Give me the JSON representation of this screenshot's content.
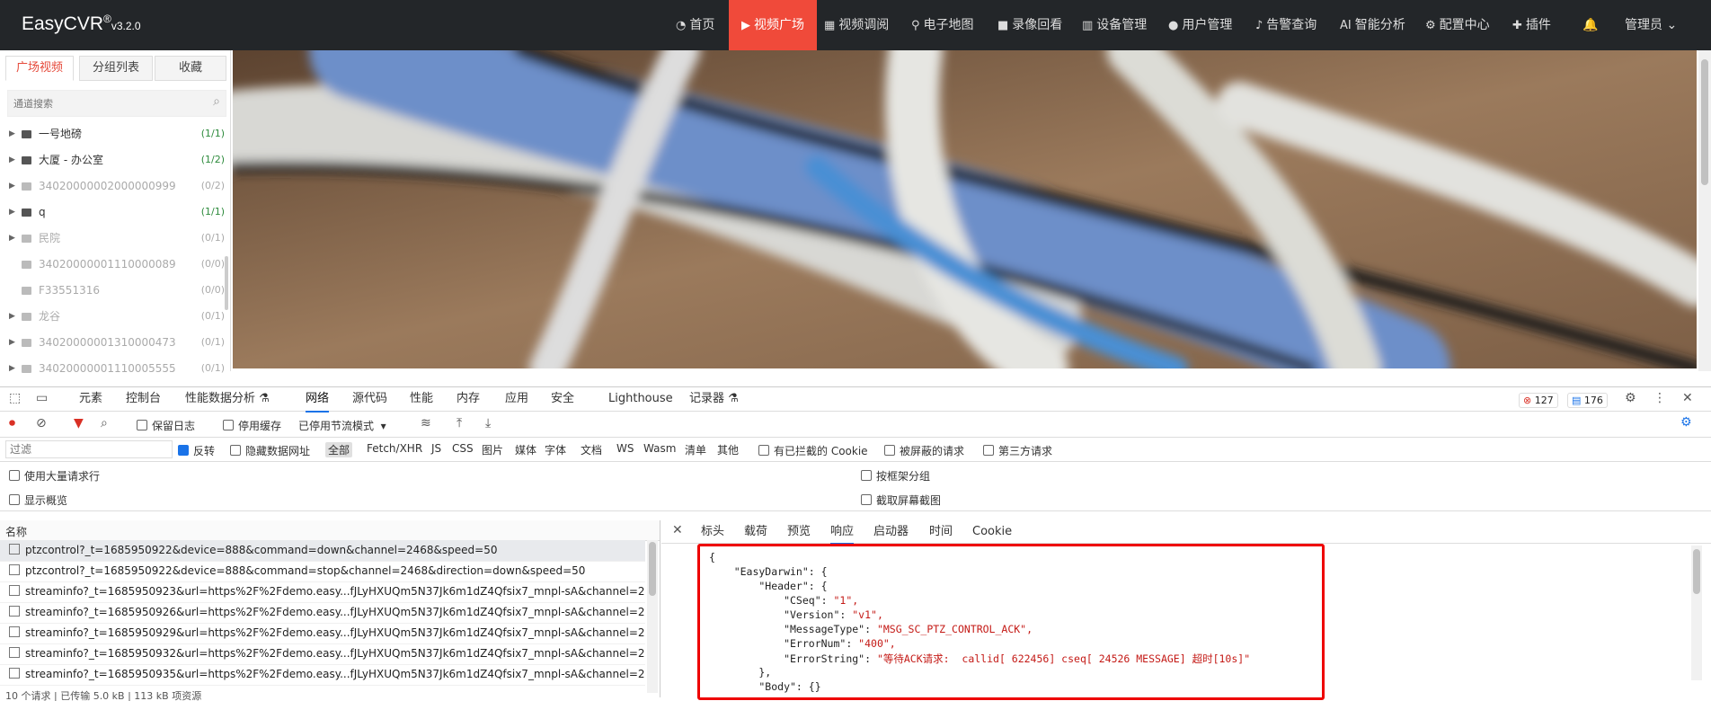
{
  "brand": {
    "name": "EasyCVR",
    "sup": "®",
    "version": "v3.2.0"
  },
  "nav": [
    {
      "icon": "dashboard-icon",
      "label": "首页"
    },
    {
      "icon": "play-circle-icon",
      "label": "视频广场",
      "active": true
    },
    {
      "icon": "grid-icon",
      "label": "视频调阅"
    },
    {
      "icon": "map-pin-icon",
      "label": "电子地图"
    },
    {
      "icon": "video-camera-icon",
      "label": "录像回看"
    },
    {
      "icon": "server-icon",
      "label": "设备管理"
    },
    {
      "icon": "user-icon",
      "label": "用户管理"
    },
    {
      "icon": "alarm-icon",
      "label": "告警查询"
    },
    {
      "icon": "ai-icon",
      "label": "智能分析"
    },
    {
      "icon": "gear-icon",
      "label": "配置中心"
    },
    {
      "icon": "puzzle-icon",
      "label": "插件"
    }
  ],
  "user": {
    "name": "管理员",
    "bell": "bell-icon"
  },
  "sidebar": {
    "tabs": [
      "广场视频",
      "分组列表",
      "收藏"
    ],
    "search_placeholder": "通道搜索",
    "tree": [
      {
        "label": "一号地磅",
        "count": "(1/1)",
        "online": true,
        "expand": true
      },
      {
        "label": "大厦 - 办公室",
        "count": "(1/2)",
        "online": true,
        "expand": true
      },
      {
        "label": "34020000002000000999",
        "count": "(0/2)",
        "online": false,
        "expand": true
      },
      {
        "label": "q",
        "count": "(1/1)",
        "online": true,
        "expand": true
      },
      {
        "label": "民院",
        "count": "(0/1)",
        "online": false,
        "expand": true
      },
      {
        "label": "34020000001110000089",
        "count": "(0/0)",
        "online": false,
        "expand": false
      },
      {
        "label": "F33551316",
        "count": "(0/0)",
        "online": false,
        "expand": false
      },
      {
        "label": "龙谷",
        "count": "(0/1)",
        "online": false,
        "expand": true
      },
      {
        "label": "34020000001310000473",
        "count": "(0/1)",
        "online": false,
        "expand": true
      },
      {
        "label": "34020000001110005555",
        "count": "(0/1)",
        "online": false,
        "expand": true
      }
    ]
  },
  "devtools": {
    "tabs": [
      "元素",
      "控制台",
      "性能数据分析 ⚗",
      "网络",
      "源代码",
      "性能",
      "内存",
      "应用",
      "安全",
      "Lighthouse",
      "记录器 ⚗"
    ],
    "active_tab": "网络",
    "errors": "127",
    "messages": "176",
    "toolbar": {
      "preserve_log": "保留日志",
      "disable_cache": "停用缓存",
      "throttle": "已停用节流模式"
    },
    "filter": {
      "placeholder": "过滤",
      "invert": "反转",
      "hide_data_urls": "隐藏数据网址",
      "types": [
        "全部",
        "Fetch/XHR",
        "JS",
        "CSS",
        "图片",
        "媒体",
        "字体",
        "文档",
        "WS",
        "Wasm",
        "清单",
        "其他"
      ],
      "blocked_cookies": "有已拦截的 Cookie",
      "blocked_requests": "被屏蔽的请求",
      "third_party": "第三方请求"
    },
    "options": {
      "big_rows": "使用大量请求行",
      "overview": "显示概览",
      "group_by_frame": "按框架分组",
      "screenshots": "截取屏幕截图"
    },
    "name_header": "名称",
    "requests": [
      "ptzcontrol?_t=1685950922&device=888&command=down&channel=2468&speed=50",
      "ptzcontrol?_t=1685950922&device=888&command=stop&channel=2468&direction=down&speed=50",
      "streaminfo?_t=1685950923&url=https%2F%2Fdemo.easy...fJLyHXUQm5N37Jk6m1dZ4Qfsix7_mnpl-sA&channel=2...",
      "streaminfo?_t=1685950926&url=https%2F%2Fdemo.easy...fJLyHXUQm5N37Jk6m1dZ4Qfsix7_mnpl-sA&channel=2...",
      "streaminfo?_t=1685950929&url=https%2F%2Fdemo.easy...fJLyHXUQm5N37Jk6m1dZ4Qfsix7_mnpl-sA&channel=2...",
      "streaminfo?_t=1685950932&url=https%2F%2Fdemo.easy...fJLyHXUQm5N37Jk6m1dZ4Qfsix7_mnpl-sA&channel=2...",
      "streaminfo?_t=1685950935&url=https%2F%2Fdemo.easy...fJLyHXUQm5N37Jk6m1dZ4Qfsix7_mnpl-sA&channel=2..."
    ],
    "status_bar": "10 个请求 | 已传输 5.0 kB | 113 kB 项资源",
    "response_tabs": [
      "标头",
      "载荷",
      "预览",
      "响应",
      "启动器",
      "时间",
      "Cookie"
    ],
    "active_response_tab": "响应",
    "response_lines": [
      {
        "k": "{",
        "s": ""
      },
      {
        "k": "    \"EasyDarwin\": {",
        "s": ""
      },
      {
        "k": "        \"Header\": {",
        "s": ""
      },
      {
        "k": "            \"CSeq\": ",
        "s": "\"1\","
      },
      {
        "k": "            \"Version\": ",
        "s": "\"v1\","
      },
      {
        "k": "            \"MessageType\": ",
        "s": "\"MSG_SC_PTZ_CONTROL_ACK\","
      },
      {
        "k": "            \"ErrorNum\": ",
        "s": "\"400\","
      },
      {
        "k": "            \"ErrorString\": ",
        "s": "\"等待ACK请求:  callid[ 622456] cseq[ 24526 MESSAGE] 超时[10s]\""
      },
      {
        "k": "        },",
        "s": ""
      },
      {
        "k": "        \"Body\": {}",
        "s": ""
      }
    ]
  }
}
